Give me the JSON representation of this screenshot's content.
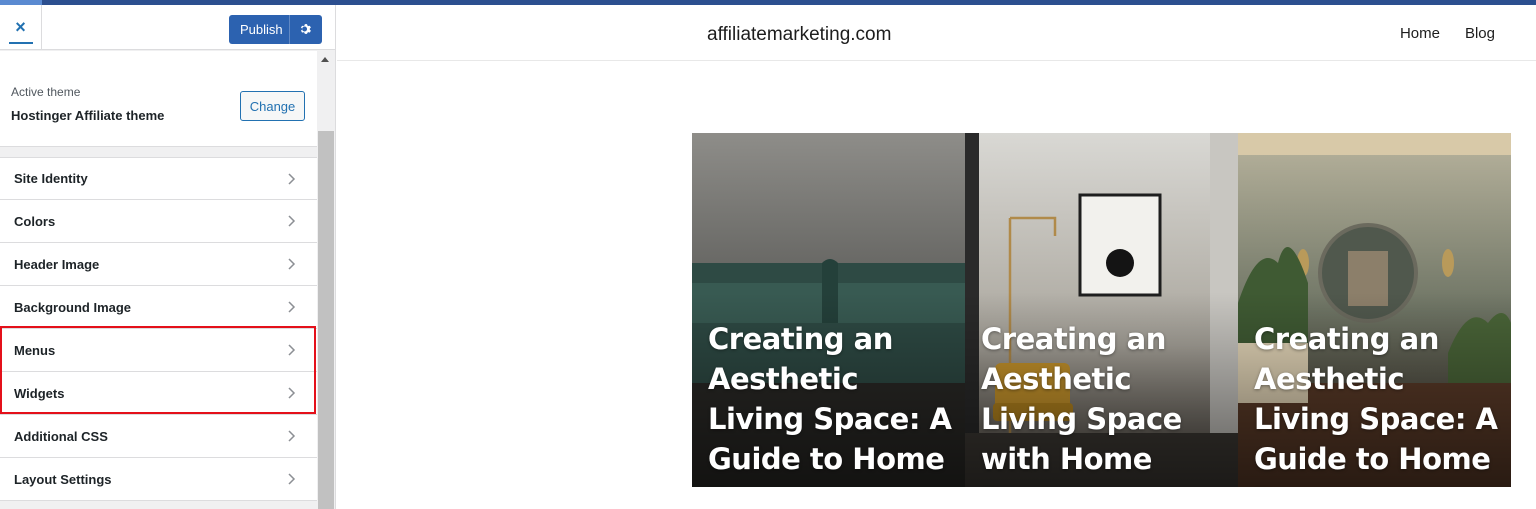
{
  "customizer": {
    "close_label": "×",
    "publish_label": "Publish",
    "active_theme_label": "Active theme",
    "theme_name": "Hostinger Affiliate theme",
    "change_label": "Change",
    "panels": [
      {
        "label": "Site Identity"
      },
      {
        "label": "Colors"
      },
      {
        "label": "Header Image"
      },
      {
        "label": "Background Image"
      },
      {
        "label": "Menus"
      },
      {
        "label": "Widgets"
      },
      {
        "label": "Additional CSS"
      },
      {
        "label": "Layout Settings"
      }
    ],
    "highlighted_panels": [
      "Menus",
      "Widgets"
    ]
  },
  "preview": {
    "site_title": "affiliatemarketing.com",
    "nav": [
      {
        "label": "Home"
      },
      {
        "label": "Blog"
      }
    ],
    "posts": [
      {
        "title": "Creating an Aesthetic Living Space: A Guide to Home Decor"
      },
      {
        "title": "Creating an Aesthetic Living Space with Home Decor"
      },
      {
        "title": "Creating an Aesthetic Living Space: A Guide to Home Decor"
      }
    ]
  },
  "colors": {
    "accent": "#2c62b0",
    "highlight_border": "#e4101a"
  }
}
